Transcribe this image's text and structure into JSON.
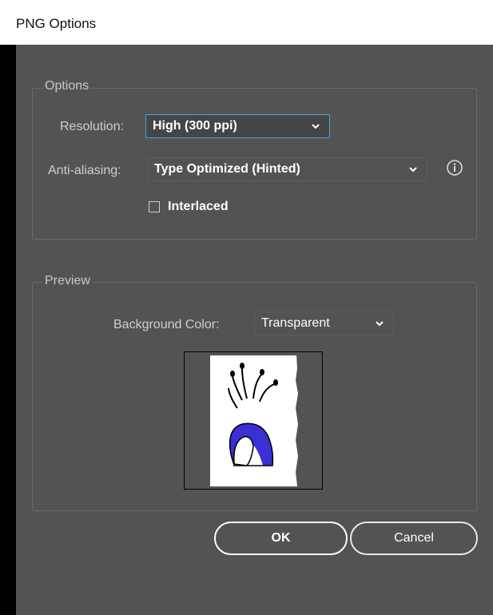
{
  "window": {
    "title": "PNG Options"
  },
  "options": {
    "legend": "Options",
    "resolution_label": "Resolution:",
    "resolution_value": "High (300 ppi)",
    "antialias_label": "Anti-aliasing:",
    "antialias_value": "Type Optimized (Hinted)",
    "interlaced_label": "Interlaced",
    "interlaced_checked": false
  },
  "preview": {
    "legend": "Preview",
    "bg_label": "Background Color:",
    "bg_value": "Transparent"
  },
  "buttons": {
    "ok": "OK",
    "cancel": "Cancel"
  },
  "colors": {
    "panel": "#535353",
    "accent_focus": "#4aa0e6",
    "vase_fill": "#3b2fd6"
  }
}
